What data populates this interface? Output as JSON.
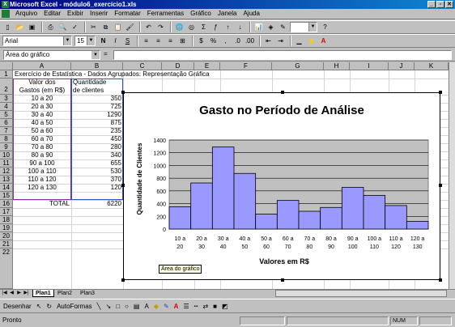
{
  "window": {
    "title": "Microsoft Excel - módulo6_exercício1.xls",
    "buttons": [
      "_",
      "▫",
      "✕"
    ]
  },
  "menu": [
    "Arquivo",
    "Editar",
    "Exibir",
    "Inserir",
    "Formatar",
    "Ferramentas",
    "Gráfico",
    "Janela",
    "Ajuda"
  ],
  "toolbar": {
    "font_name": "Arial",
    "font_size": "15",
    "bold": "N",
    "italic": "I",
    "underline": "S"
  },
  "formula_bar": {
    "name_box": "Área do gráfico",
    "formula": ""
  },
  "columns": [
    "A",
    "B",
    "C",
    "D",
    "E",
    "F",
    "G",
    "H",
    "I",
    "J",
    "K"
  ],
  "rows": [
    "1",
    "2",
    "3",
    "4",
    "5",
    "6",
    "7",
    "8",
    "9",
    "10",
    "11",
    "12",
    "13",
    "14",
    "15",
    "16",
    "17",
    "18",
    "19",
    "20",
    "21",
    "22"
  ],
  "sheet": {
    "title_cell": "Exercício de Estatística - Dados Agrupados: Representação Gráfica",
    "header_a_line1": "Valor dos",
    "header_a_line2": "Gastos (em R$)",
    "header_b_line1": "Quantidade",
    "header_b_line2": "de clientes",
    "classes": [
      "10 a 20",
      "20 a 30",
      "30 a 40",
      "40 a 50",
      "50 a 60",
      "60 a 70",
      "70 a 80",
      "80 a 90",
      "90 a 100",
      "100 a 110",
      "110 a 120",
      "120 a 130"
    ],
    "counts": [
      "350",
      "725",
      "1290",
      "875",
      "235",
      "450",
      "280",
      "340",
      "655",
      "530",
      "370",
      "120"
    ],
    "total_label": "TOTAL",
    "total_value": "6220"
  },
  "chart_data": {
    "type": "bar",
    "title": "Gasto no Período de Análise",
    "xlabel": "Valores em R$",
    "ylabel": "Quantidade de Clientes",
    "categories_line1": [
      "10 a",
      "20 a",
      "30 a",
      "40 a",
      "50 a",
      "60 a",
      "70 a",
      "80 a",
      "90 a",
      "100 a",
      "110 a",
      "120 a"
    ],
    "categories_line2": [
      "20",
      "30",
      "40",
      "50",
      "60",
      "70",
      "80",
      "90",
      "100",
      "110",
      "120",
      "130"
    ],
    "values": [
      350,
      725,
      1290,
      875,
      235,
      450,
      280,
      340,
      655,
      530,
      370,
      120
    ],
    "ylim": [
      0,
      1400
    ],
    "yticks": [
      "0",
      "200",
      "400",
      "600",
      "800",
      "1000",
      "1200",
      "1400"
    ],
    "grid": true,
    "plot_bg": "#c0c0c0",
    "bar_color": "#9999ff"
  },
  "chart_tooltip": "Área do gráfico",
  "sheet_tabs": [
    "Plan1",
    "Plan2",
    "Plan3"
  ],
  "drawing_toolbar": {
    "draw_label": "Desenhar",
    "autoshapes_label": "AutoFormas"
  },
  "status": {
    "text": "Pronto",
    "num": "NUM"
  }
}
